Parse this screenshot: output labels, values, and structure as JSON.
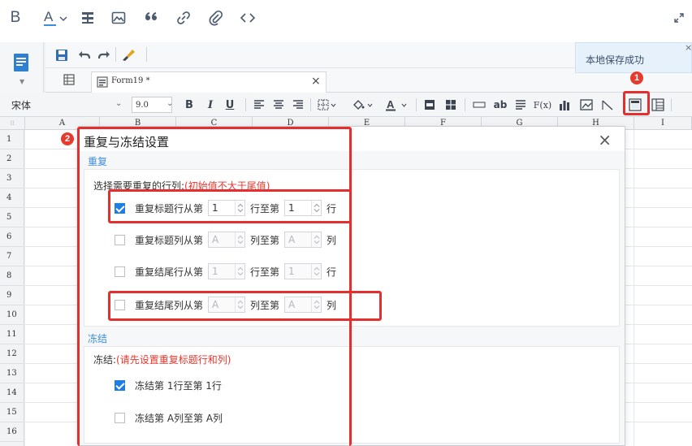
{
  "toast": {
    "message": "本地保存成功",
    "close": "×"
  },
  "tab": {
    "title": "Form19 *",
    "close": "×"
  },
  "format_bar": {
    "font_name": "宋体",
    "font_size": "9.0",
    "bold": "B",
    "italic": "I",
    "underline": "U",
    "text_ab": "ab",
    "fx": "F(x)"
  },
  "grid": {
    "columns": [
      "A",
      "B",
      "C",
      "D",
      "E",
      "F",
      "G",
      "H",
      "I"
    ],
    "rows": [
      "1",
      "2",
      "3",
      "4",
      "5",
      "6",
      "7",
      "8",
      "9",
      "10",
      "11",
      "12",
      "13",
      "14",
      "15",
      "16"
    ]
  },
  "dialog": {
    "title": "重复与冻结设置",
    "close": "×",
    "repeat": {
      "section": "重复",
      "note": "选择需要重复的行列:",
      "note_warn": "(初始值不大于尾值)",
      "rows": [
        {
          "checked": true,
          "label": "重复标题行从第",
          "from": "1",
          "mid": "行至第",
          "to": "1",
          "unit": "行",
          "disabled": false
        },
        {
          "checked": false,
          "label": "重复标题列从第",
          "from": "A",
          "mid": "列至第",
          "to": "A",
          "unit": "列",
          "disabled": true
        },
        {
          "checked": false,
          "label": "重复结尾行从第",
          "from": "1",
          "mid": "行至第",
          "to": "1",
          "unit": "行",
          "disabled": true
        },
        {
          "checked": false,
          "label": "重复结尾列从第",
          "from": "A",
          "mid": "列至第",
          "to": "A",
          "unit": "列",
          "disabled": true
        }
      ]
    },
    "freeze": {
      "section": "冻结",
      "note": "冻结:",
      "note_warn": "(请先设置重复标题行和列)",
      "rows": [
        {
          "checked": true,
          "label": "冻结第 1行至第 1行"
        },
        {
          "checked": false,
          "label": "冻结第 A列至第 A列"
        }
      ]
    }
  },
  "annotations": {
    "badge1": "1",
    "badge2": "2"
  },
  "colors": {
    "accent": "#1f7ee6",
    "highlight": "#e52e2e",
    "warning": "#e8372e",
    "section": "#3c8dde"
  }
}
